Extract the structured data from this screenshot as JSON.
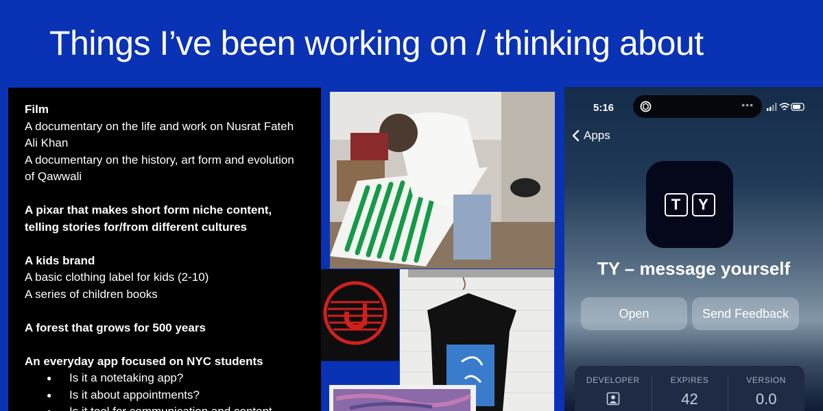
{
  "slide": {
    "title": "Things I’ve been working on / thinking about"
  },
  "text_panel": {
    "film_heading": "Film",
    "film_item_1": "A documentary on the life and work on Nusrat Fateh Ali Khan",
    "film_item_2": "A documentary on the history, art form and evolution of Qawwali",
    "pixar": "A pixar that makes short form niche content, telling stories for/from different cultures",
    "kids_heading": "A kids brand",
    "kids_item_1": "A basic clothing label for kids (2-10)",
    "kids_item_2": "A series of children books",
    "forest": "A forest that grows for 500 years",
    "app_heading": "An everyday app focused on NYC students",
    "app_bullets": [
      "Is it a notetaking app?",
      "Is it about appointments?",
      "Is it tool for communication and content"
    ]
  },
  "phone": {
    "time": "5:16",
    "back_label": "Apps",
    "icon_letters": [
      "T",
      "Y"
    ],
    "app_name": "TY – message yourself",
    "open_label": "Open",
    "feedback_label": "Send Feedback",
    "info": {
      "developer_label": "DEVELOPER",
      "expires_label": "EXPIRES",
      "expires_value": "42",
      "version_label": "VERSION",
      "version_value": "0.0"
    }
  },
  "colors": {
    "background": "#0a32b4",
    "panel": "#000000",
    "green_paint": "#1a9e4a",
    "logo_red": "#d0201e"
  }
}
